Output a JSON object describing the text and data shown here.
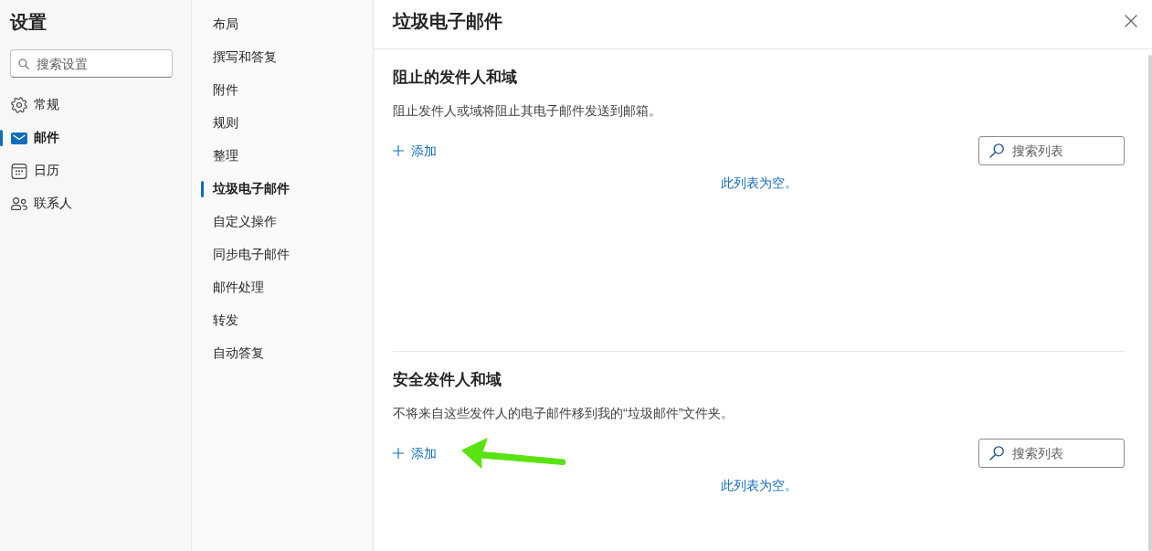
{
  "settings_nav": {
    "title": "设置",
    "search": {
      "placeholder": "搜索设置"
    },
    "items": [
      {
        "label": "常规",
        "kind": "gear",
        "selected": false
      },
      {
        "label": "邮件",
        "kind": "mail",
        "selected": true
      },
      {
        "label": "日历",
        "kind": "calendar",
        "selected": false
      },
      {
        "label": "联系人",
        "kind": "people",
        "selected": false
      }
    ]
  },
  "mail_settings": {
    "items": [
      {
        "label": "布局",
        "selected": false
      },
      {
        "label": "撰写和答复",
        "selected": false
      },
      {
        "label": "附件",
        "selected": false
      },
      {
        "label": "规则",
        "selected": false
      },
      {
        "label": "整理",
        "selected": false
      },
      {
        "label": "垃圾电子邮件",
        "selected": true
      },
      {
        "label": "自定义操作",
        "selected": false
      },
      {
        "label": "同步电子邮件",
        "selected": false
      },
      {
        "label": "邮件处理",
        "selected": false
      },
      {
        "label": "转发",
        "selected": false
      },
      {
        "label": "自动答复",
        "selected": false
      }
    ]
  },
  "junk_email_panel": {
    "title": "垃圾电子邮件",
    "sections": [
      {
        "heading": "阻止的发件人和域",
        "description": "阻止发件人或域将阻止其电子邮件发送到邮箱。",
        "add_button": "添加",
        "search": {
          "placeholder": "搜索列表"
        },
        "empty_message": "此列表为空。"
      },
      {
        "heading": "安全发件人和域",
        "description": "不将来自这些发件人的电子邮件移到我的“垃圾邮件”文件夹。",
        "add_button": "添加",
        "search": {
          "placeholder": "搜索列表"
        },
        "empty_message": "此列表为空。",
        "annotation": {
          "kind": "arrow"
        }
      }
    ]
  }
}
